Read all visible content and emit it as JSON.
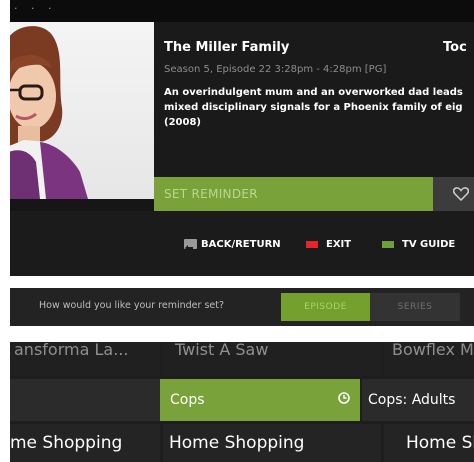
{
  "programme": {
    "title": "The Miller Family",
    "day": "Toc",
    "episode_line": "Season 5, Episode 22 3:28pm - 4:28pm [PG]",
    "description_lines": [
      "An overindulgent mum and an overworked dad leads",
      "mixed disciplinary signals for a Phoenix family of eig",
      "(2008)"
    ]
  },
  "actions": {
    "set_reminder": "SET REMINDER",
    "favourite_icon": "heart-icon"
  },
  "legend": {
    "back": "BACK/RETURN",
    "exit": "EXIT",
    "guide": "TV GUIDE",
    "colors": {
      "exit": "#e3262a",
      "guide": "#6fa13a"
    }
  },
  "reminder_prompt": {
    "question": "How would you like your reminder set?",
    "options": [
      "EPISODE",
      "SERIES"
    ],
    "selected": "EPISODE"
  },
  "grid": {
    "row1": [
      "ansforma La...",
      "Twist A Saw",
      "Bowflex Ma"
    ],
    "row2": [
      "Cops",
      "Cops: Adults"
    ],
    "row3": [
      "me Shopping",
      "Home Shopping",
      "Home Sh"
    ]
  },
  "accent_color": "#7aa23a"
}
